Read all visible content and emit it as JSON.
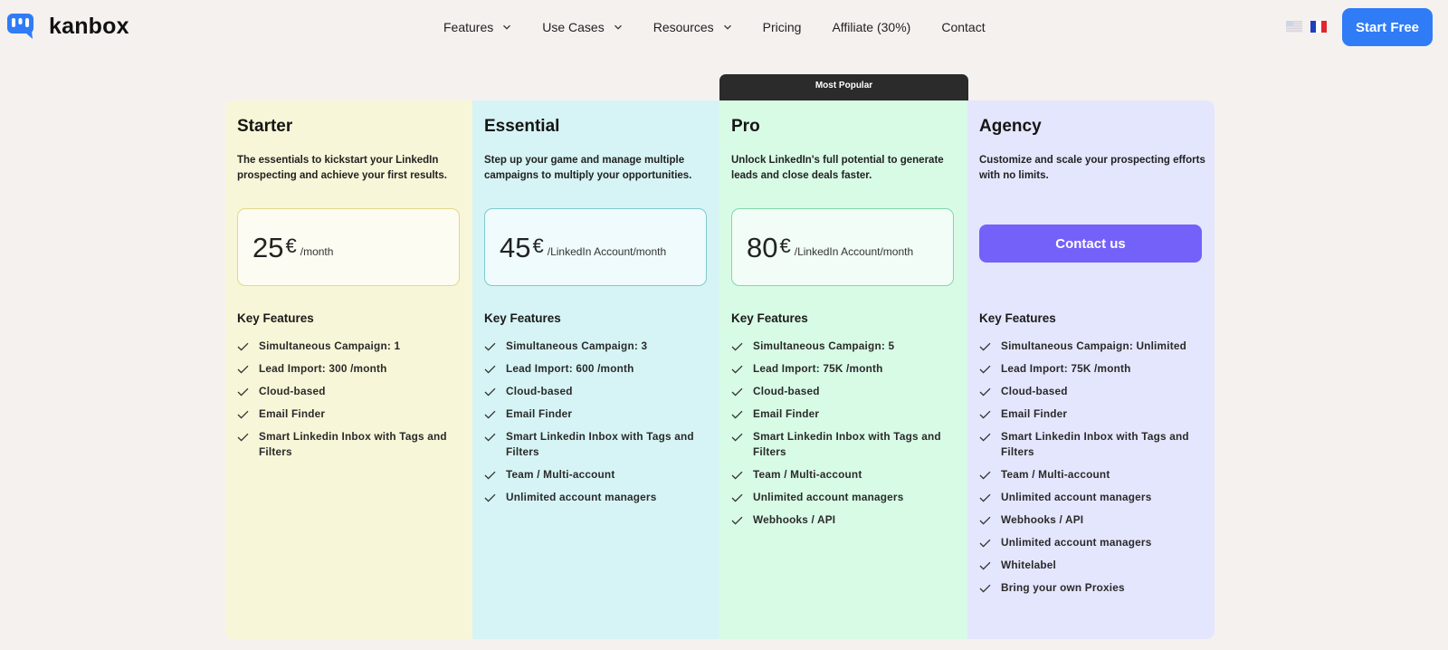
{
  "header": {
    "brand": "kanbox",
    "nav": [
      {
        "label": "Features",
        "dropdown": true
      },
      {
        "label": "Use Cases",
        "dropdown": true
      },
      {
        "label": "Resources",
        "dropdown": true
      },
      {
        "label": "Pricing",
        "dropdown": false
      },
      {
        "label": "Affiliate (30%)",
        "dropdown": false
      },
      {
        "label": "Contact",
        "dropdown": false
      }
    ],
    "languages": [
      "en-flag-icon",
      "fr-flag-icon"
    ],
    "cta_label": "Start Free"
  },
  "colors": {
    "brand_blue": "#2f7cf6",
    "contact_purple": "#7461f9",
    "starter_bg": "#f8f6d8",
    "essential_bg": "#d6f4f5",
    "pro_bg": "#d8fbe6",
    "agency_bg": "#e4e6fd"
  },
  "pricing": {
    "popular_badge": "Most Popular",
    "key_features_label": "Key Features",
    "plans": [
      {
        "name": "Starter",
        "description": "The essentials to kickstart your LinkedIn prospecting and achieve your first results.",
        "price": "25",
        "currency": "€",
        "period": "/month",
        "features": [
          "Simultaneous Campaign: 1",
          "Lead Import: 300 /month",
          "Cloud-based",
          "Email Finder",
          "Smart Linkedin Inbox with Tags and Filters"
        ]
      },
      {
        "name": "Essential",
        "description": "Step up your game and manage multiple campaigns to multiply your opportunities.",
        "price": "45",
        "currency": "€",
        "period": "/LinkedIn Account/month",
        "features": [
          "Simultaneous Campaign: 3",
          "Lead Import: 600 /month",
          "Cloud-based",
          "Email Finder",
          "Smart Linkedin Inbox with Tags and Filters",
          "Team / Multi-account",
          "Unlimited account managers"
        ]
      },
      {
        "name": "Pro",
        "description": "Unlock LinkedIn's full potential to generate leads and close deals faster.",
        "price": "80",
        "currency": "€",
        "period": "/LinkedIn Account/month",
        "features": [
          "Simultaneous Campaign: 5",
          "Lead Import: 75K /month",
          "Cloud-based",
          "Email Finder",
          "Smart Linkedin Inbox with Tags and Filters",
          "Team / Multi-account",
          "Unlimited account managers",
          "Webhooks / API"
        ]
      },
      {
        "name": "Agency",
        "description": "Customize and scale your prospecting efforts with no limits.",
        "cta_label": "Contact us",
        "features": [
          "Simultaneous Campaign: Unlimited",
          "Lead Import: 75K /month",
          "Cloud-based",
          "Email Finder",
          "Smart Linkedin Inbox with Tags and Filters",
          "Team / Multi-account",
          "Unlimited account managers",
          "Webhooks / API",
          "Unlimited account managers",
          "Whitelabel",
          "Bring your own Proxies"
        ]
      }
    ]
  }
}
